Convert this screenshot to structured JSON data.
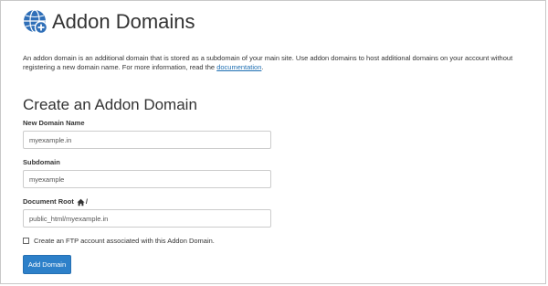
{
  "page": {
    "title": "Addon Domains",
    "icon": "globe-plus-icon",
    "description_text": "An addon domain is an additional domain that is stored as a subdomain of your main site. Use addon domains to host additional domains on your account without registering a new domain name. For more information, read the ",
    "description_link": "documentation",
    "description_end": "."
  },
  "form": {
    "title": "Create an Addon Domain",
    "new_domain": {
      "label": "New Domain Name",
      "value": "myexample.in"
    },
    "subdomain": {
      "label": "Subdomain",
      "value": "myexample"
    },
    "document_root": {
      "label": "Document Root",
      "icon": "home-icon",
      "suffix": "/",
      "value": "public_html/myexample.in"
    },
    "ftp_checkbox": {
      "label": "Create an FTP account associated with this Addon Domain.",
      "checked": false
    },
    "submit_label": "Add Domain"
  },
  "colors": {
    "accent": "#2d80c9",
    "link": "#1f6fb2",
    "icon_blue": "#2f6fb8"
  }
}
